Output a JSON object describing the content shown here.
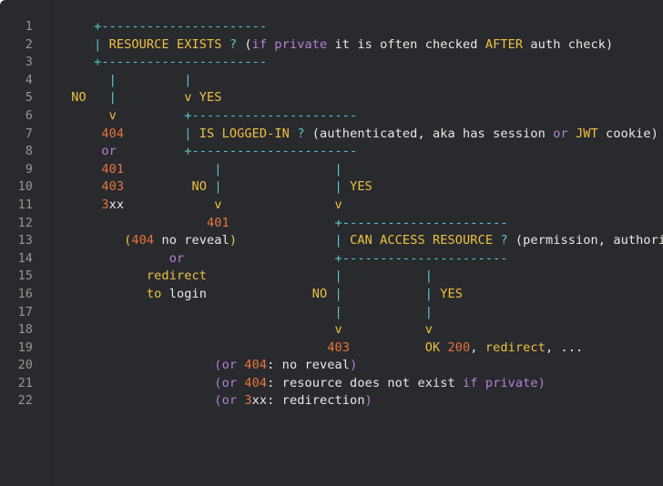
{
  "editor": {
    "background_color": "#282a2e",
    "gutter_color": "#969896",
    "text_color": "#e8e8e8",
    "palette": {
      "cyan": "#5cc8c8",
      "gold": "#f0c040",
      "orange": "#e8743b",
      "purple": "#b87fd4",
      "white": "#e8e8e8"
    },
    "line_count": 22,
    "line_numbers": [
      "1",
      "2",
      "3",
      "4",
      "5",
      "6",
      "7",
      "8",
      "9",
      "10",
      "11",
      "12",
      "13",
      "14",
      "15",
      "16",
      "17",
      "18",
      "19",
      "20",
      "21",
      "22"
    ],
    "plain_text": [
      "    +----------------------",
      "    | RESOURCE EXISTS ? (if private it is often checked AFTER auth check)",
      "    +----------------------",
      "      |         |",
      " NO   |         v YES",
      "      v         +----------------------",
      "     404        | IS LOGGED-IN ? (authenticated, aka has session or JWT cookie)",
      "     or         +----------------------",
      "     401            |               |",
      "     403         NO |               | YES",
      "     3xx            v               v",
      "                   401              +----------------------",
      "        (404 no reveal)             | CAN ACCESS RESOURCE ? (permission, authorized, ...)",
      "              or                    +----------------------",
      "           redirect                 |           |",
      "           to login              NO |           | YES",
      "                                    |           |",
      "                                    v           v",
      "                                   403          OK 200, redirect, ...",
      "                    (or 404: no reveal)",
      "                    (or 404: resource does not exist if private)",
      "                    (or 3xx: redirection)"
    ],
    "lines": [
      {
        "n": "1",
        "spans": [
          {
            "t": "    ",
            "c": "white"
          },
          {
            "t": "+----------------------",
            "c": "cyan"
          }
        ]
      },
      {
        "n": "2",
        "spans": [
          {
            "t": "    ",
            "c": "white"
          },
          {
            "t": "|",
            "c": "cyan"
          },
          {
            "t": " ",
            "c": "white"
          },
          {
            "t": "RESOURCE EXISTS",
            "c": "gold"
          },
          {
            "t": " ",
            "c": "white"
          },
          {
            "t": "?",
            "c": "cyan"
          },
          {
            "t": " (",
            "c": "white"
          },
          {
            "t": "if",
            "c": "purple"
          },
          {
            "t": " ",
            "c": "white"
          },
          {
            "t": "private",
            "c": "purple"
          },
          {
            "t": " it is often checked ",
            "c": "white"
          },
          {
            "t": "AFTER",
            "c": "gold"
          },
          {
            "t": " auth check)",
            "c": "white"
          }
        ]
      },
      {
        "n": "3",
        "spans": [
          {
            "t": "    ",
            "c": "white"
          },
          {
            "t": "+----------------------",
            "c": "cyan"
          }
        ]
      },
      {
        "n": "4",
        "spans": [
          {
            "t": "      ",
            "c": "white"
          },
          {
            "t": "|",
            "c": "cyan"
          },
          {
            "t": "         ",
            "c": "white"
          },
          {
            "t": "|",
            "c": "cyan"
          }
        ]
      },
      {
        "n": "5",
        "spans": [
          {
            "t": " ",
            "c": "white"
          },
          {
            "t": "NO",
            "c": "gold"
          },
          {
            "t": "   ",
            "c": "white"
          },
          {
            "t": "|",
            "c": "cyan"
          },
          {
            "t": "         ",
            "c": "white"
          },
          {
            "t": "v YES",
            "c": "gold"
          }
        ]
      },
      {
        "n": "6",
        "spans": [
          {
            "t": "      ",
            "c": "white"
          },
          {
            "t": "v",
            "c": "gold"
          },
          {
            "t": "         ",
            "c": "white"
          },
          {
            "t": "+----------------------",
            "c": "cyan"
          }
        ]
      },
      {
        "n": "7",
        "spans": [
          {
            "t": "     ",
            "c": "white"
          },
          {
            "t": "404",
            "c": "orange"
          },
          {
            "t": "        ",
            "c": "white"
          },
          {
            "t": "|",
            "c": "cyan"
          },
          {
            "t": " ",
            "c": "white"
          },
          {
            "t": "IS LOGGED-IN",
            "c": "gold"
          },
          {
            "t": " ",
            "c": "white"
          },
          {
            "t": "?",
            "c": "cyan"
          },
          {
            "t": " (authenticated, aka has session ",
            "c": "white"
          },
          {
            "t": "or",
            "c": "purple"
          },
          {
            "t": " ",
            "c": "white"
          },
          {
            "t": "JWT",
            "c": "gold"
          },
          {
            "t": " cookie)",
            "c": "white"
          }
        ]
      },
      {
        "n": "8",
        "spans": [
          {
            "t": "     ",
            "c": "white"
          },
          {
            "t": "or",
            "c": "purple"
          },
          {
            "t": "         ",
            "c": "white"
          },
          {
            "t": "+----------------------",
            "c": "cyan"
          }
        ]
      },
      {
        "n": "9",
        "spans": [
          {
            "t": "     ",
            "c": "white"
          },
          {
            "t": "401",
            "c": "orange"
          },
          {
            "t": "            ",
            "c": "white"
          },
          {
            "t": "|",
            "c": "cyan"
          },
          {
            "t": "               ",
            "c": "white"
          },
          {
            "t": "|",
            "c": "cyan"
          }
        ]
      },
      {
        "n": "10",
        "spans": [
          {
            "t": "     ",
            "c": "white"
          },
          {
            "t": "403",
            "c": "orange"
          },
          {
            "t": "         ",
            "c": "white"
          },
          {
            "t": "NO",
            "c": "gold"
          },
          {
            "t": " ",
            "c": "white"
          },
          {
            "t": "|",
            "c": "cyan"
          },
          {
            "t": "               ",
            "c": "white"
          },
          {
            "t": "|",
            "c": "cyan"
          },
          {
            "t": " ",
            "c": "white"
          },
          {
            "t": "YES",
            "c": "gold"
          }
        ]
      },
      {
        "n": "11",
        "spans": [
          {
            "t": "     ",
            "c": "white"
          },
          {
            "t": "3",
            "c": "orange"
          },
          {
            "t": "xx",
            "c": "white"
          },
          {
            "t": "            ",
            "c": "white"
          },
          {
            "t": "v",
            "c": "gold"
          },
          {
            "t": "               ",
            "c": "white"
          },
          {
            "t": "v",
            "c": "gold"
          }
        ]
      },
      {
        "n": "12",
        "spans": [
          {
            "t": "                   ",
            "c": "white"
          },
          {
            "t": "401",
            "c": "orange"
          },
          {
            "t": "              ",
            "c": "white"
          },
          {
            "t": "+----------------------",
            "c": "cyan"
          }
        ]
      },
      {
        "n": "13",
        "spans": [
          {
            "t": "        ",
            "c": "white"
          },
          {
            "t": "(",
            "c": "gold"
          },
          {
            "t": "404",
            "c": "orange"
          },
          {
            "t": " no reveal",
            "c": "white"
          },
          {
            "t": ")",
            "c": "gold"
          },
          {
            "t": "             ",
            "c": "white"
          },
          {
            "t": "|",
            "c": "cyan"
          },
          {
            "t": " ",
            "c": "white"
          },
          {
            "t": "CAN ACCESS RESOURCE",
            "c": "gold"
          },
          {
            "t": " ",
            "c": "white"
          },
          {
            "t": "?",
            "c": "cyan"
          },
          {
            "t": " (permission, authorized, ...)",
            "c": "white"
          }
        ]
      },
      {
        "n": "14",
        "spans": [
          {
            "t": "              ",
            "c": "white"
          },
          {
            "t": "or",
            "c": "purple"
          },
          {
            "t": "                    ",
            "c": "white"
          },
          {
            "t": "+----------------------",
            "c": "cyan"
          }
        ]
      },
      {
        "n": "15",
        "spans": [
          {
            "t": "           ",
            "c": "white"
          },
          {
            "t": "redirect",
            "c": "gold"
          },
          {
            "t": "                 ",
            "c": "white"
          },
          {
            "t": "|",
            "c": "cyan"
          },
          {
            "t": "           ",
            "c": "white"
          },
          {
            "t": "|",
            "c": "cyan"
          }
        ]
      },
      {
        "n": "16",
        "spans": [
          {
            "t": "           ",
            "c": "white"
          },
          {
            "t": "to",
            "c": "gold"
          },
          {
            "t": " login",
            "c": "white"
          },
          {
            "t": "              ",
            "c": "white"
          },
          {
            "t": "NO",
            "c": "gold"
          },
          {
            "t": " ",
            "c": "white"
          },
          {
            "t": "|",
            "c": "cyan"
          },
          {
            "t": "           ",
            "c": "white"
          },
          {
            "t": "|",
            "c": "cyan"
          },
          {
            "t": " ",
            "c": "white"
          },
          {
            "t": "YES",
            "c": "gold"
          }
        ]
      },
      {
        "n": "17",
        "spans": [
          {
            "t": "                                    ",
            "c": "white"
          },
          {
            "t": "|",
            "c": "cyan"
          },
          {
            "t": "           ",
            "c": "white"
          },
          {
            "t": "|",
            "c": "cyan"
          }
        ]
      },
      {
        "n": "18",
        "spans": [
          {
            "t": "                                    ",
            "c": "white"
          },
          {
            "t": "v",
            "c": "gold"
          },
          {
            "t": "           ",
            "c": "white"
          },
          {
            "t": "v",
            "c": "gold"
          }
        ]
      },
      {
        "n": "19",
        "spans": [
          {
            "t": "                                   ",
            "c": "white"
          },
          {
            "t": "403",
            "c": "orange"
          },
          {
            "t": "          ",
            "c": "white"
          },
          {
            "t": "OK",
            "c": "gold"
          },
          {
            "t": " ",
            "c": "white"
          },
          {
            "t": "200",
            "c": "orange"
          },
          {
            "t": ", ",
            "c": "white"
          },
          {
            "t": "redirect",
            "c": "gold"
          },
          {
            "t": ", ...",
            "c": "white"
          }
        ]
      },
      {
        "n": "20",
        "spans": [
          {
            "t": "                    ",
            "c": "white"
          },
          {
            "t": "(",
            "c": "purple"
          },
          {
            "t": "or",
            "c": "purple"
          },
          {
            "t": " ",
            "c": "white"
          },
          {
            "t": "404",
            "c": "orange"
          },
          {
            "t": ": no reveal",
            "c": "white"
          },
          {
            "t": ")",
            "c": "purple"
          }
        ]
      },
      {
        "n": "21",
        "spans": [
          {
            "t": "                    ",
            "c": "white"
          },
          {
            "t": "(",
            "c": "purple"
          },
          {
            "t": "or",
            "c": "purple"
          },
          {
            "t": " ",
            "c": "white"
          },
          {
            "t": "404",
            "c": "orange"
          },
          {
            "t": ": resource does not exist ",
            "c": "white"
          },
          {
            "t": "if",
            "c": "purple"
          },
          {
            "t": " ",
            "c": "white"
          },
          {
            "t": "private",
            "c": "purple"
          },
          {
            "t": ")",
            "c": "purple"
          }
        ]
      },
      {
        "n": "22",
        "spans": [
          {
            "t": "                    ",
            "c": "white"
          },
          {
            "t": "(",
            "c": "purple"
          },
          {
            "t": "or",
            "c": "purple"
          },
          {
            "t": " ",
            "c": "white"
          },
          {
            "t": "3",
            "c": "orange"
          },
          {
            "t": "xx",
            "c": "white"
          },
          {
            "t": ": redirection",
            "c": "white"
          },
          {
            "t": ")",
            "c": "purple"
          }
        ]
      }
    ]
  }
}
